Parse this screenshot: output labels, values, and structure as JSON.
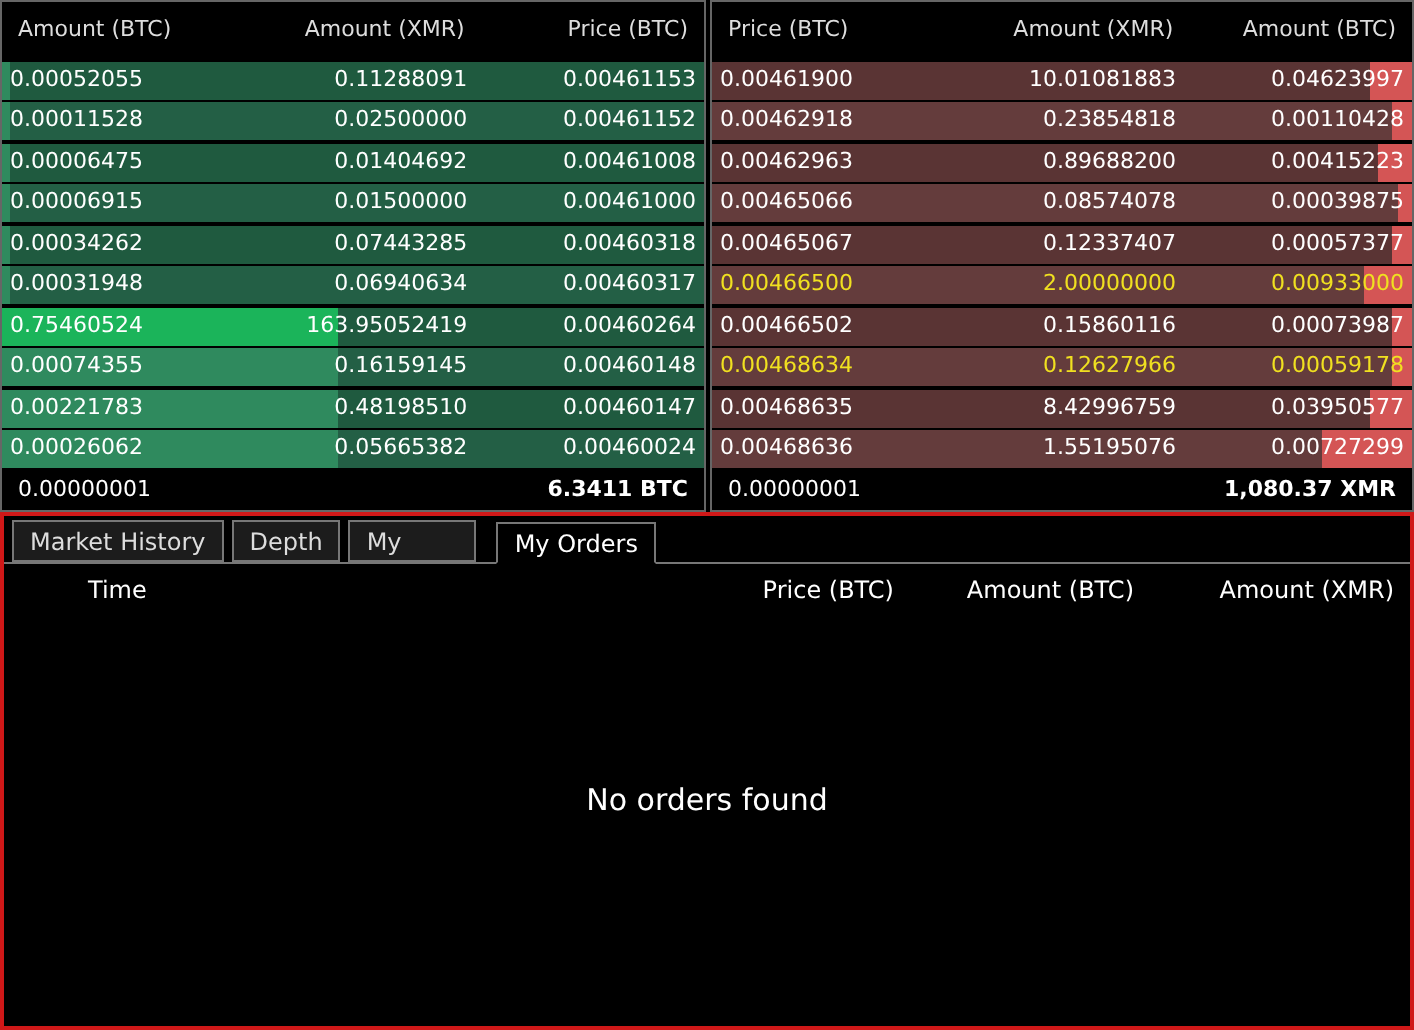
{
  "buy_book": {
    "columns": [
      "Amount (BTC)",
      "Amount (XMR)",
      "Price (BTC)"
    ],
    "rows": [
      {
        "cells": [
          "0.00052055",
          "0.11288091",
          "0.00461153"
        ],
        "level": 0.01,
        "selected": false
      },
      {
        "cells": [
          "0.00011528",
          "0.02500000",
          "0.00461152"
        ],
        "level": 0.01,
        "selected": false
      },
      {
        "cells": [
          "0.00006475",
          "0.01404692",
          "0.00461008"
        ],
        "level": 0.01,
        "selected": false
      },
      {
        "cells": [
          "0.00006915",
          "0.01500000",
          "0.00461000"
        ],
        "level": 0.01,
        "selected": false
      },
      {
        "cells": [
          "0.00034262",
          "0.07443285",
          "0.00460318"
        ],
        "level": 0.01,
        "selected": false
      },
      {
        "cells": [
          "0.00031948",
          "0.06940634",
          "0.00460317"
        ],
        "level": 0.01,
        "selected": false
      },
      {
        "cells": [
          "0.75460524",
          "163.95052419",
          "0.00460264"
        ],
        "level": 0.48,
        "selected": true
      },
      {
        "cells": [
          "0.00074355",
          "0.16159145",
          "0.00460148"
        ],
        "level": 0.48,
        "selected": false
      },
      {
        "cells": [
          "0.00221783",
          "0.48198510",
          "0.00460147"
        ],
        "level": 0.48,
        "selected": false
      },
      {
        "cells": [
          "0.00026062",
          "0.05665382",
          "0.00460024"
        ],
        "level": 0.48,
        "selected": false
      }
    ],
    "footer": [
      "0.00000001",
      "6.3411 BTC"
    ]
  },
  "sell_book": {
    "columns": [
      "Price (BTC)",
      "Amount (XMR)",
      "Amount (BTC)"
    ],
    "rows": [
      {
        "cells": [
          "0.00461900",
          "10.01081883",
          "0.04623997"
        ],
        "level": 0.06,
        "highlighted": false
      },
      {
        "cells": [
          "0.00462918",
          "0.23854818",
          "0.00110428"
        ],
        "level": 0.03,
        "highlighted": false
      },
      {
        "cells": [
          "0.00462963",
          "0.89688200",
          "0.00415223"
        ],
        "level": 0.05,
        "highlighted": false
      },
      {
        "cells": [
          "0.00465066",
          "0.08574078",
          "0.00039875"
        ],
        "level": 0.02,
        "highlighted": false
      },
      {
        "cells": [
          "0.00465067",
          "0.12337407",
          "0.00057377"
        ],
        "level": 0.03,
        "highlighted": false
      },
      {
        "cells": [
          "0.00466500",
          "2.00000000",
          "0.00933000"
        ],
        "level": 0.07,
        "highlighted": true
      },
      {
        "cells": [
          "0.00466502",
          "0.15860116",
          "0.00073987"
        ],
        "level": 0.03,
        "highlighted": false
      },
      {
        "cells": [
          "0.00468634",
          "0.12627966",
          "0.00059178"
        ],
        "level": 0.03,
        "highlighted": true
      },
      {
        "cells": [
          "0.00468635",
          "8.42996759",
          "0.03950577"
        ],
        "level": 0.06,
        "highlighted": false
      },
      {
        "cells": [
          "0.00468636",
          "1.55195076",
          "0.00727299"
        ],
        "level": 0.13,
        "highlighted": false
      }
    ],
    "footer": [
      "0.00000001",
      "1,080.37 XMR"
    ]
  },
  "tabs": [
    {
      "label": "Market History",
      "selected": false
    },
    {
      "label": "Depth",
      "selected": false
    },
    {
      "label": "My",
      "selected": false
    },
    {
      "label": "My Orders",
      "selected": true
    }
  ],
  "orders_table": {
    "columns": [
      "Time",
      "Price (BTC)",
      "Amount (BTC)",
      "Amount (XMR)"
    ],
    "empty_message": "No orders found"
  }
}
